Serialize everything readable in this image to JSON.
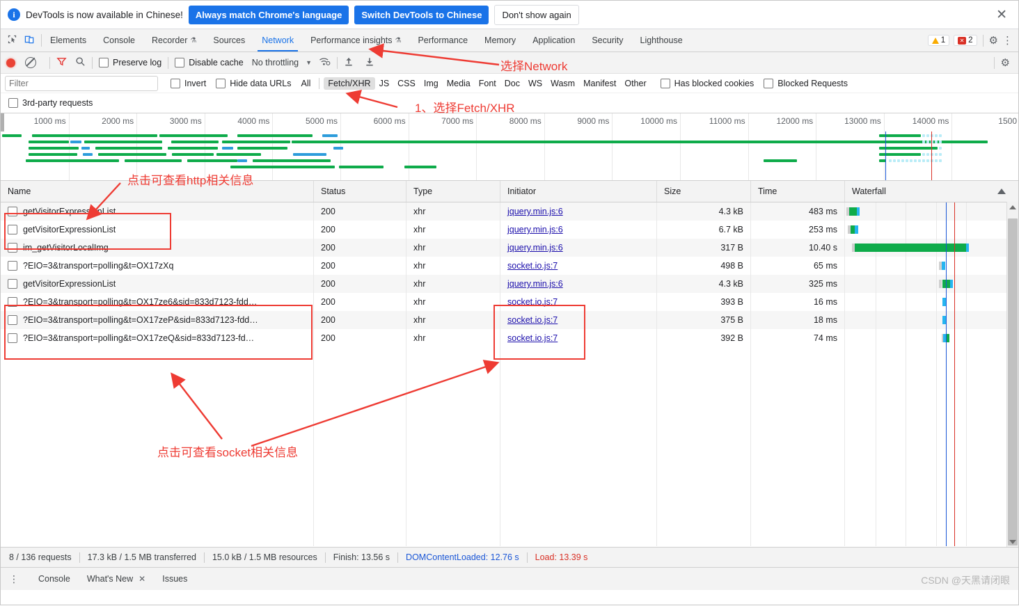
{
  "infobar": {
    "message": "DevTools is now available in Chinese!",
    "btn_match": "Always match Chrome's language",
    "btn_switch": "Switch DevTools to Chinese",
    "btn_dismiss": "Don't show again",
    "close_icon": "close-icon",
    "info_icon": "info-icon",
    "icon_glyph": "i",
    "close_glyph": "✕"
  },
  "tabbar": {
    "inspect_icon": "inspect-element-icon",
    "device_icon": "device-toolbar-icon",
    "tabs": [
      {
        "label": "Elements",
        "active": false,
        "experimental": false
      },
      {
        "label": "Console",
        "active": false,
        "experimental": false
      },
      {
        "label": "Recorder",
        "active": false,
        "experimental": true
      },
      {
        "label": "Sources",
        "active": false,
        "experimental": false
      },
      {
        "label": "Network",
        "active": true,
        "experimental": false
      },
      {
        "label": "Performance insights",
        "active": false,
        "experimental": true
      },
      {
        "label": "Performance",
        "active": false,
        "experimental": false
      },
      {
        "label": "Memory",
        "active": false,
        "experimental": false
      },
      {
        "label": "Application",
        "active": false,
        "experimental": false
      },
      {
        "label": "Security",
        "active": false,
        "experimental": false
      },
      {
        "label": "Lighthouse",
        "active": false,
        "experimental": false
      }
    ],
    "experimental_glyph": "⚗",
    "warning_count": "1",
    "error_count": "2",
    "error_glyph": "✕",
    "settings_icon": "gear-icon",
    "more_icon": "more-options-icon",
    "settings_glyph": "⚙",
    "more_glyph": "⋮"
  },
  "net_toolbar": {
    "record_icon": "record-button",
    "clear_icon": "clear-button",
    "filter_icon": "filter-icon",
    "search_icon": "search-icon",
    "preserve_log": "Preserve log",
    "disable_cache": "Disable cache",
    "throttling": "No throttling",
    "throttle_caret": "▼",
    "wifi_icon": "network-conditions-icon",
    "import_icon": "import-har-icon",
    "export_icon": "export-har-icon",
    "settings_icon": "gear-icon",
    "settings_glyph": "⚙"
  },
  "filterbar": {
    "placeholder": "Filter",
    "value": "",
    "invert": "Invert",
    "hide_data_urls": "Hide data URLs",
    "types": [
      "All",
      "Fetch/XHR",
      "JS",
      "CSS",
      "Img",
      "Media",
      "Font",
      "Doc",
      "WS",
      "Wasm",
      "Manifest",
      "Other"
    ],
    "selected_type": "Fetch/XHR",
    "has_blocked_cookies": "Has blocked cookies",
    "blocked_requests": "Blocked Requests",
    "third_party": "3rd-party requests"
  },
  "overview": {
    "ticks": [
      "1000 ms",
      "2000 ms",
      "3000 ms",
      "4000 ms",
      "5000 ms",
      "6000 ms",
      "7000 ms",
      "8000 ms",
      "9000 ms",
      "10000 ms",
      "11000 ms",
      "12000 ms",
      "13000 ms",
      "14000 ms",
      "1500"
    ],
    "dcl_color": "#1a56d6",
    "load_color": "#d93025"
  },
  "grid": {
    "columns": [
      "Name",
      "Status",
      "Type",
      "Initiator",
      "Size",
      "Time",
      "Waterfall"
    ],
    "sort_indicator": "▲",
    "rows": [
      {
        "name": "getVisitorExpressionList",
        "status": "200",
        "type": "xhr",
        "initiator": "jquery.min.js:6",
        "size": "4.3 kB",
        "time": "483 ms"
      },
      {
        "name": "getVisitorExpressionList",
        "status": "200",
        "type": "xhr",
        "initiator": "jquery.min.js:6",
        "size": "6.7 kB",
        "time": "253 ms"
      },
      {
        "name": "im_getVisitorLocalImg",
        "status": "200",
        "type": "xhr",
        "initiator": "jquery.min.js:6",
        "size": "317 B",
        "time": "10.40 s"
      },
      {
        "name": "?EIO=3&transport=polling&t=OX17zXq",
        "status": "200",
        "type": "xhr",
        "initiator": "socket.io.js:7",
        "size": "498 B",
        "time": "65 ms"
      },
      {
        "name": "getVisitorExpressionList",
        "status": "200",
        "type": "xhr",
        "initiator": "jquery.min.js:6",
        "size": "4.3 kB",
        "time": "325 ms"
      },
      {
        "name": "?EIO=3&transport=polling&t=OX17ze6&sid=833d7123-fdd…",
        "status": "200",
        "type": "xhr",
        "initiator": "socket.io.js:7",
        "size": "393 B",
        "time": "16 ms"
      },
      {
        "name": "?EIO=3&transport=polling&t=OX17zeP&sid=833d7123-fdd…",
        "status": "200",
        "type": "xhr",
        "initiator": "socket.io.js:7",
        "size": "375 B",
        "time": "18 ms"
      },
      {
        "name": "?EIO=3&transport=polling&t=OX17zeQ&sid=833d7123-fd…",
        "status": "200",
        "type": "xhr",
        "initiator": "socket.io.js:7",
        "size": "392 B",
        "time": "74 ms"
      }
    ]
  },
  "summary": {
    "requests": "8 / 136 requests",
    "transferred": "17.3 kB / 1.5 MB transferred",
    "resources": "15.0 kB / 1.5 MB resources",
    "finish": "Finish: 13.56 s",
    "dom_content_loaded": "DOMContentLoaded: 12.76 s",
    "load": "Load: 13.39 s"
  },
  "drawer": {
    "more_glyph": "⋮",
    "tabs": [
      {
        "label": "Console",
        "closable": false
      },
      {
        "label": "What's New",
        "closable": true
      },
      {
        "label": "Issues",
        "closable": false
      }
    ],
    "close_glyph": "✕",
    "watermark": "CSDN @天黑请闭眼"
  },
  "annotations": {
    "select_network": "选择Network",
    "select_fetch_xhr": "1、选择Fetch/XHR",
    "http_info": "点击可查看http相关信息",
    "socket_info": "点击可查看socket相关信息",
    "color": "#ee3b33"
  }
}
